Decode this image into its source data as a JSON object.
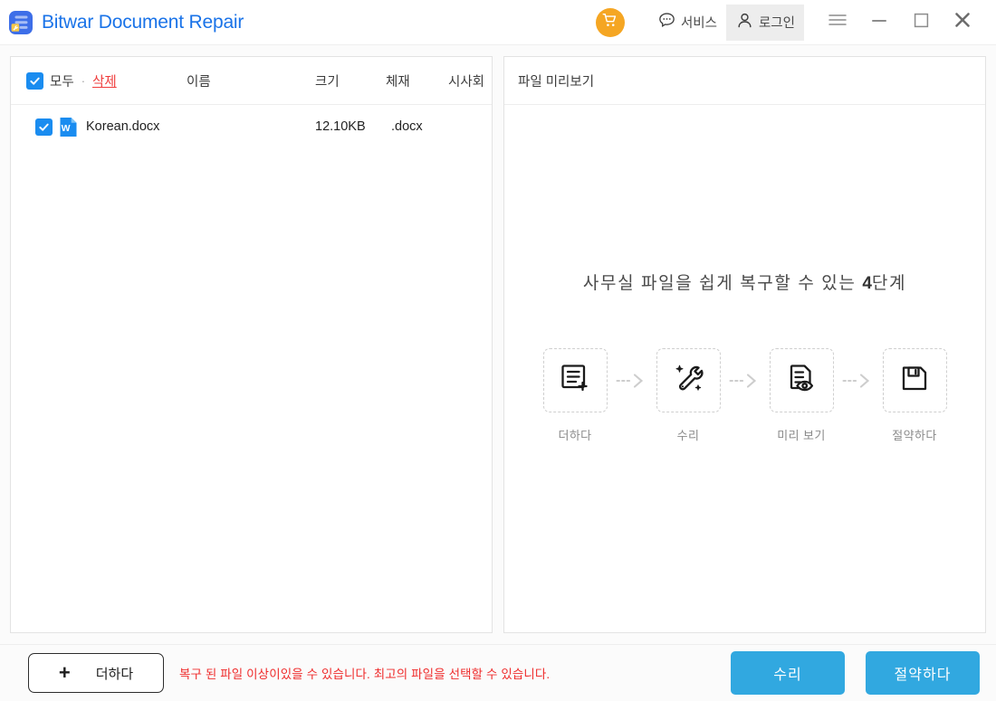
{
  "titlebar": {
    "app_title": "Bitwar Document Repair",
    "logo_icon": "document-wrench-icon",
    "cart_icon": "shopping-cart-icon",
    "service_icon": "chat-bubble-icon",
    "service_label": "서비스",
    "login_icon": "user-person-icon",
    "login_label": "로그인",
    "menu_icon": "hamburger-menu-icon",
    "minimize_icon": "minimize-icon",
    "maximize_icon": "maximize-icon",
    "close_icon": "close-icon",
    "brand_color": "#1a73e8",
    "cart_color": "#f5a623"
  },
  "file_list": {
    "select_all_label": "모두",
    "separator": "·",
    "delete_label": "삭제",
    "delete_color": "#ef3b3b",
    "columns": {
      "name": "이름",
      "size": "크기",
      "format": "체재",
      "preview": "시사회"
    },
    "rows": [
      {
        "checked": true,
        "icon": "word-document-icon",
        "name": "Korean.docx",
        "size": "12.10KB",
        "format": ".docx"
      }
    ]
  },
  "preview": {
    "header": "파일 미리보기",
    "steps_title_prefix": "사무실 파일을 쉽게 복구할 수 있는 ",
    "steps_title_number": "4",
    "steps_title_suffix": "단계",
    "steps": [
      {
        "icon": "document-add-icon",
        "label": "더하다"
      },
      {
        "icon": "wrench-repair-icon",
        "label": "수리"
      },
      {
        "icon": "document-eye-preview-icon",
        "label": "미리 보기"
      },
      {
        "icon": "floppy-disk-save-icon",
        "label": "절약하다"
      }
    ],
    "connector_icon": "dotted-arrow-right-icon"
  },
  "footer": {
    "add_icon": "plus-icon",
    "add_label": "더하다",
    "warning_text": "복구 된 파일 이상이있을 수 있습니다. 최고의 파일을 선택할 수 있습니다.",
    "warning_color": "#ef2c2c",
    "repair_label": "수리",
    "save_label": "절약하다",
    "button_color": "#31a8e0"
  }
}
